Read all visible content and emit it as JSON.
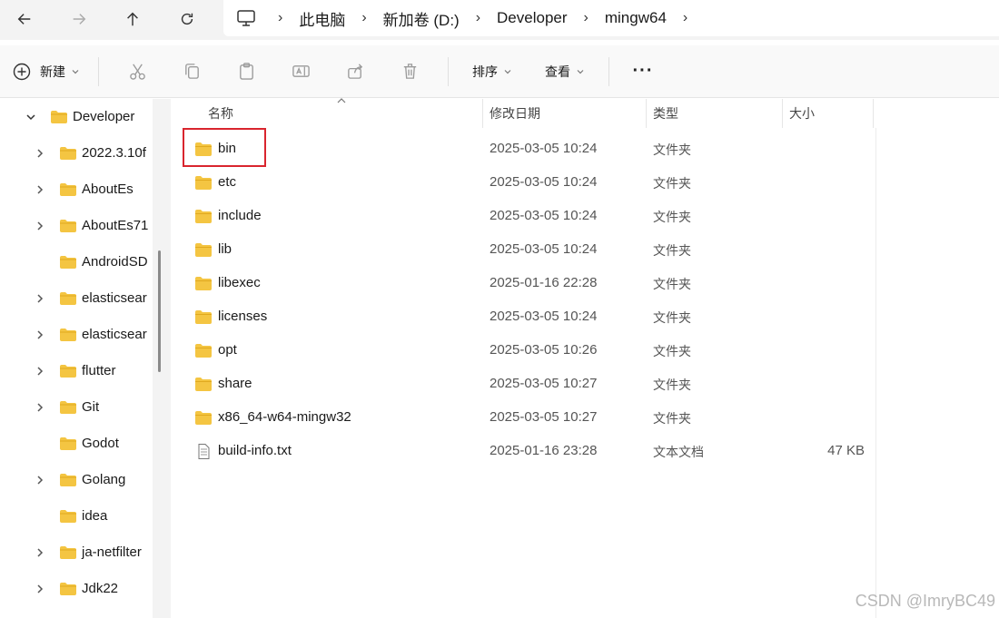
{
  "breadcrumb": {
    "items": [
      "此电脑",
      "新加卷 (D:)",
      "Developer",
      "mingw64"
    ]
  },
  "toolbar": {
    "new_label": "新建",
    "sort_label": "排序",
    "view_label": "查看",
    "more_label": "···"
  },
  "sidebar": {
    "root": "Developer",
    "items": [
      {
        "label": "2022.3.10f",
        "expandable": true
      },
      {
        "label": "AboutEs",
        "expandable": true
      },
      {
        "label": "AboutEs71",
        "expandable": true
      },
      {
        "label": "AndroidSD",
        "expandable": false
      },
      {
        "label": "elasticsear",
        "expandable": true
      },
      {
        "label": "elasticsear",
        "expandable": true
      },
      {
        "label": "flutter",
        "expandable": true
      },
      {
        "label": "Git",
        "expandable": true
      },
      {
        "label": "Godot",
        "expandable": false
      },
      {
        "label": "Golang",
        "expandable": true
      },
      {
        "label": "idea",
        "expandable": false
      },
      {
        "label": "ja-netfilter",
        "expandable": true
      },
      {
        "label": "Jdk22",
        "expandable": true
      }
    ]
  },
  "columns": {
    "name": "名称",
    "modified": "修改日期",
    "type": "类型",
    "size": "大小"
  },
  "files": [
    {
      "name": "bin",
      "modified": "2025-03-05 10:24",
      "type": "文件夹",
      "size": "",
      "kind": "folder"
    },
    {
      "name": "etc",
      "modified": "2025-03-05 10:24",
      "type": "文件夹",
      "size": "",
      "kind": "folder"
    },
    {
      "name": "include",
      "modified": "2025-03-05 10:24",
      "type": "文件夹",
      "size": "",
      "kind": "folder"
    },
    {
      "name": "lib",
      "modified": "2025-03-05 10:24",
      "type": "文件夹",
      "size": "",
      "kind": "folder"
    },
    {
      "name": "libexec",
      "modified": "2025-01-16 22:28",
      "type": "文件夹",
      "size": "",
      "kind": "folder"
    },
    {
      "name": "licenses",
      "modified": "2025-03-05 10:24",
      "type": "文件夹",
      "size": "",
      "kind": "folder"
    },
    {
      "name": "opt",
      "modified": "2025-03-05 10:26",
      "type": "文件夹",
      "size": "",
      "kind": "folder"
    },
    {
      "name": "share",
      "modified": "2025-03-05 10:27",
      "type": "文件夹",
      "size": "",
      "kind": "folder"
    },
    {
      "name": "x86_64-w64-mingw32",
      "modified": "2025-03-05 10:27",
      "type": "文件夹",
      "size": "",
      "kind": "folder"
    },
    {
      "name": "build-info.txt",
      "modified": "2025-01-16 23:28",
      "type": "文本文档",
      "size": "47 KB",
      "kind": "file"
    }
  ],
  "watermark": "CSDN @ImryBC49",
  "colors": {
    "folder": "#f4c542",
    "folder_dark": "#e0a91f",
    "highlight": "#d9252e"
  }
}
